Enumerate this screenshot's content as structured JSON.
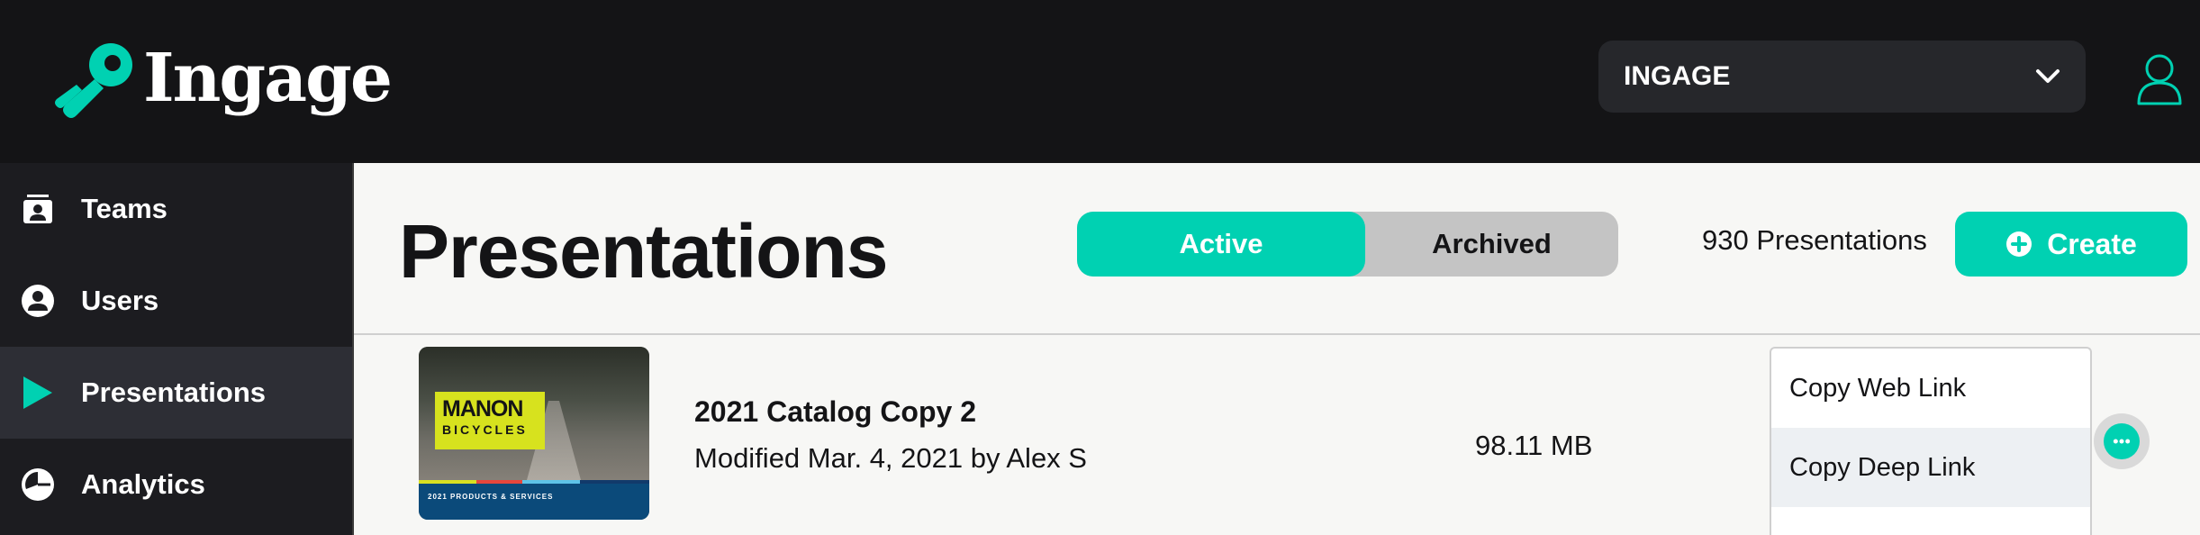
{
  "header": {
    "logo_text": "Ingage",
    "org_select": {
      "value": "INGAGE"
    }
  },
  "sidebar": {
    "items": [
      {
        "label": "Teams",
        "icon": "teams-icon"
      },
      {
        "label": "Users",
        "icon": "user-circle-icon"
      },
      {
        "label": "Presentations",
        "icon": "play-icon",
        "active": true
      },
      {
        "label": "Analytics",
        "icon": "pie-chart-icon"
      }
    ]
  },
  "main": {
    "title": "Presentations",
    "toggle": {
      "active_label": "Active",
      "archived_label": "Archived",
      "selected": "Active"
    },
    "count_text": "930 Presentations",
    "create_label": "Create",
    "rows": [
      {
        "title": "2021 Catalog Copy 2",
        "meta": "Modified Mar. 4, 2021 by Alex S",
        "size": "98.11 MB",
        "thumbnail": {
          "brand_line1": "MANON",
          "brand_line2": "BICYCLES",
          "band_text": "2021 PRODUCTS & SERVICES"
        }
      }
    ]
  },
  "context_menu": {
    "items": [
      {
        "label": "Copy Web Link"
      },
      {
        "label": "Copy Deep Link",
        "highlighted": true
      }
    ]
  },
  "colors": {
    "accent": "#00d1b2",
    "topbar": "#141416",
    "sidebar": "#1c1c20",
    "sidebar_active": "#2d2e35",
    "main_bg": "#f7f7f5"
  }
}
